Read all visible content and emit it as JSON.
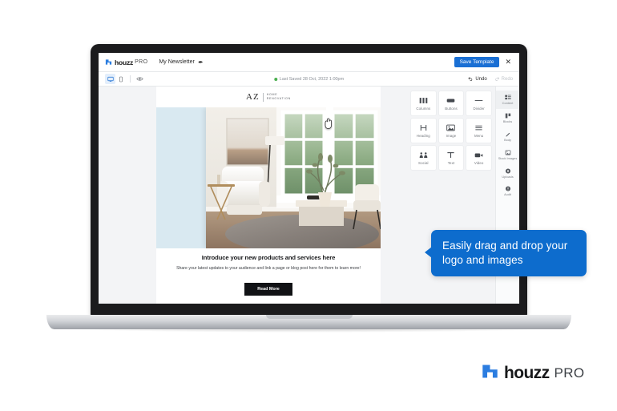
{
  "app": {
    "brand_word": "houzz",
    "brand_suffix": "PRO",
    "document_title": "My Newsletter",
    "edit_icon": "pencil-icon",
    "save_template_label": "Save Template",
    "close_icon": "close-icon"
  },
  "toolbar": {
    "devices": [
      {
        "name": "desktop-icon",
        "label": "Desktop",
        "active": true
      },
      {
        "name": "mobile-icon",
        "label": "Mobile",
        "active": false
      },
      {
        "name": "preview-eye-icon",
        "label": "Preview",
        "active": false
      }
    ],
    "save_status": "Last Saved 28 Oct, 2022 1:00pm",
    "undo_label": "Undo",
    "redo_label": "Redo"
  },
  "email": {
    "logo_mark": "AZ",
    "logo_line1": "HOME",
    "logo_line2": "RENOVATION",
    "heading": "Introduce your new products and services here",
    "body": "Share your latest updates to your audience and link a page or blog post here for them to learn more!",
    "button_label": "Read More"
  },
  "tools": [
    {
      "icon": "columns-icon",
      "label": "Columns"
    },
    {
      "icon": "button-icon",
      "label": "Buttons"
    },
    {
      "icon": "divider-icon",
      "label": "Divider"
    },
    {
      "icon": "heading-icon",
      "label": "Heading"
    },
    {
      "icon": "image-icon",
      "label": "Image"
    },
    {
      "icon": "menu-icon",
      "label": "Menu"
    },
    {
      "icon": "social-icon",
      "label": "Social"
    },
    {
      "icon": "text-icon",
      "label": "Text"
    },
    {
      "icon": "video-icon",
      "label": "Video"
    }
  ],
  "rail": [
    {
      "icon": "content-icon",
      "label": "Content",
      "active": true
    },
    {
      "icon": "blocks-icon",
      "label": "Blocks",
      "active": false
    },
    {
      "icon": "body-icon",
      "label": "Body",
      "active": false
    },
    {
      "icon": "stock-images-icon",
      "label": "Stock Images",
      "active": false
    },
    {
      "icon": "uploads-icon",
      "label": "Uploads",
      "active": false
    },
    {
      "icon": "audit-icon",
      "label": "Audit",
      "active": false
    }
  ],
  "callout": {
    "text": "Easily drag and drop your logo and images"
  },
  "footer": {
    "brand_word": "houzz",
    "brand_suffix": "PRO"
  },
  "colors": {
    "accent_blue": "#1a6fd4",
    "callout_blue": "#0d6ccd",
    "status_green": "#4caf50",
    "dropzone_blue": "#d9e9f1"
  }
}
